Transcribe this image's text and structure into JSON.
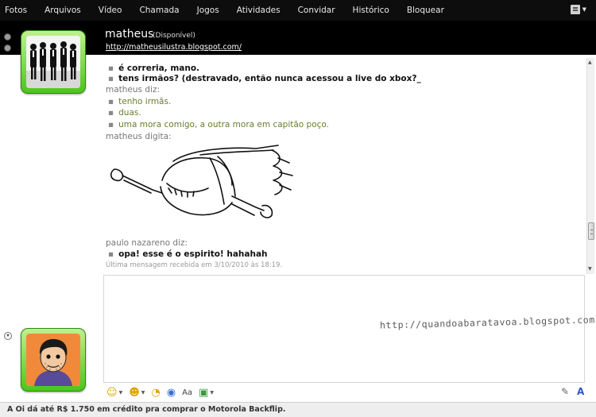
{
  "menu": {
    "items": [
      "Fotos",
      "Arquivos",
      "Vídeo",
      "Chamada",
      "Jogos",
      "Atividades",
      "Convidar",
      "Histórico",
      "Bloquear"
    ]
  },
  "contact": {
    "name": "matheus",
    "status": "(Disponível)",
    "link": "http://matheusilustra.blogspot.com/"
  },
  "messages": [
    {
      "type": "bullet",
      "style": "bold",
      "text": "é correria, mano."
    },
    {
      "type": "bullet",
      "style": "bold",
      "text": "tens irmãos? (destravado, então nunca acessou a live do xbox?_"
    },
    {
      "type": "sender",
      "text": "matheus diz:"
    },
    {
      "type": "bullet",
      "style": "green",
      "text": "tenho irmãs."
    },
    {
      "type": "bullet",
      "style": "green",
      "text": "duas."
    },
    {
      "type": "bullet",
      "style": "green",
      "text": "uma mora comigo, a outra mora em capitão poço."
    },
    {
      "type": "sender",
      "text": "matheus digita:"
    },
    {
      "type": "sender",
      "text": "paulo nazareno diz:"
    },
    {
      "type": "bullet",
      "style": "bold",
      "text": "opa! esse é o espirito! hahahah"
    }
  ],
  "last_message": "Última mensagem recebida em 3/10/2010 às 18:19.",
  "watermark": "http://quandoabaratavoa.blogspot.com",
  "ad": "A Oi dá até R$ 1.750 em crédito pra comprar o Motorola Backflip.",
  "colors": {
    "accent_green": "#4cc51a",
    "message_green": "#6a7d2a",
    "header_black": "#000000"
  }
}
